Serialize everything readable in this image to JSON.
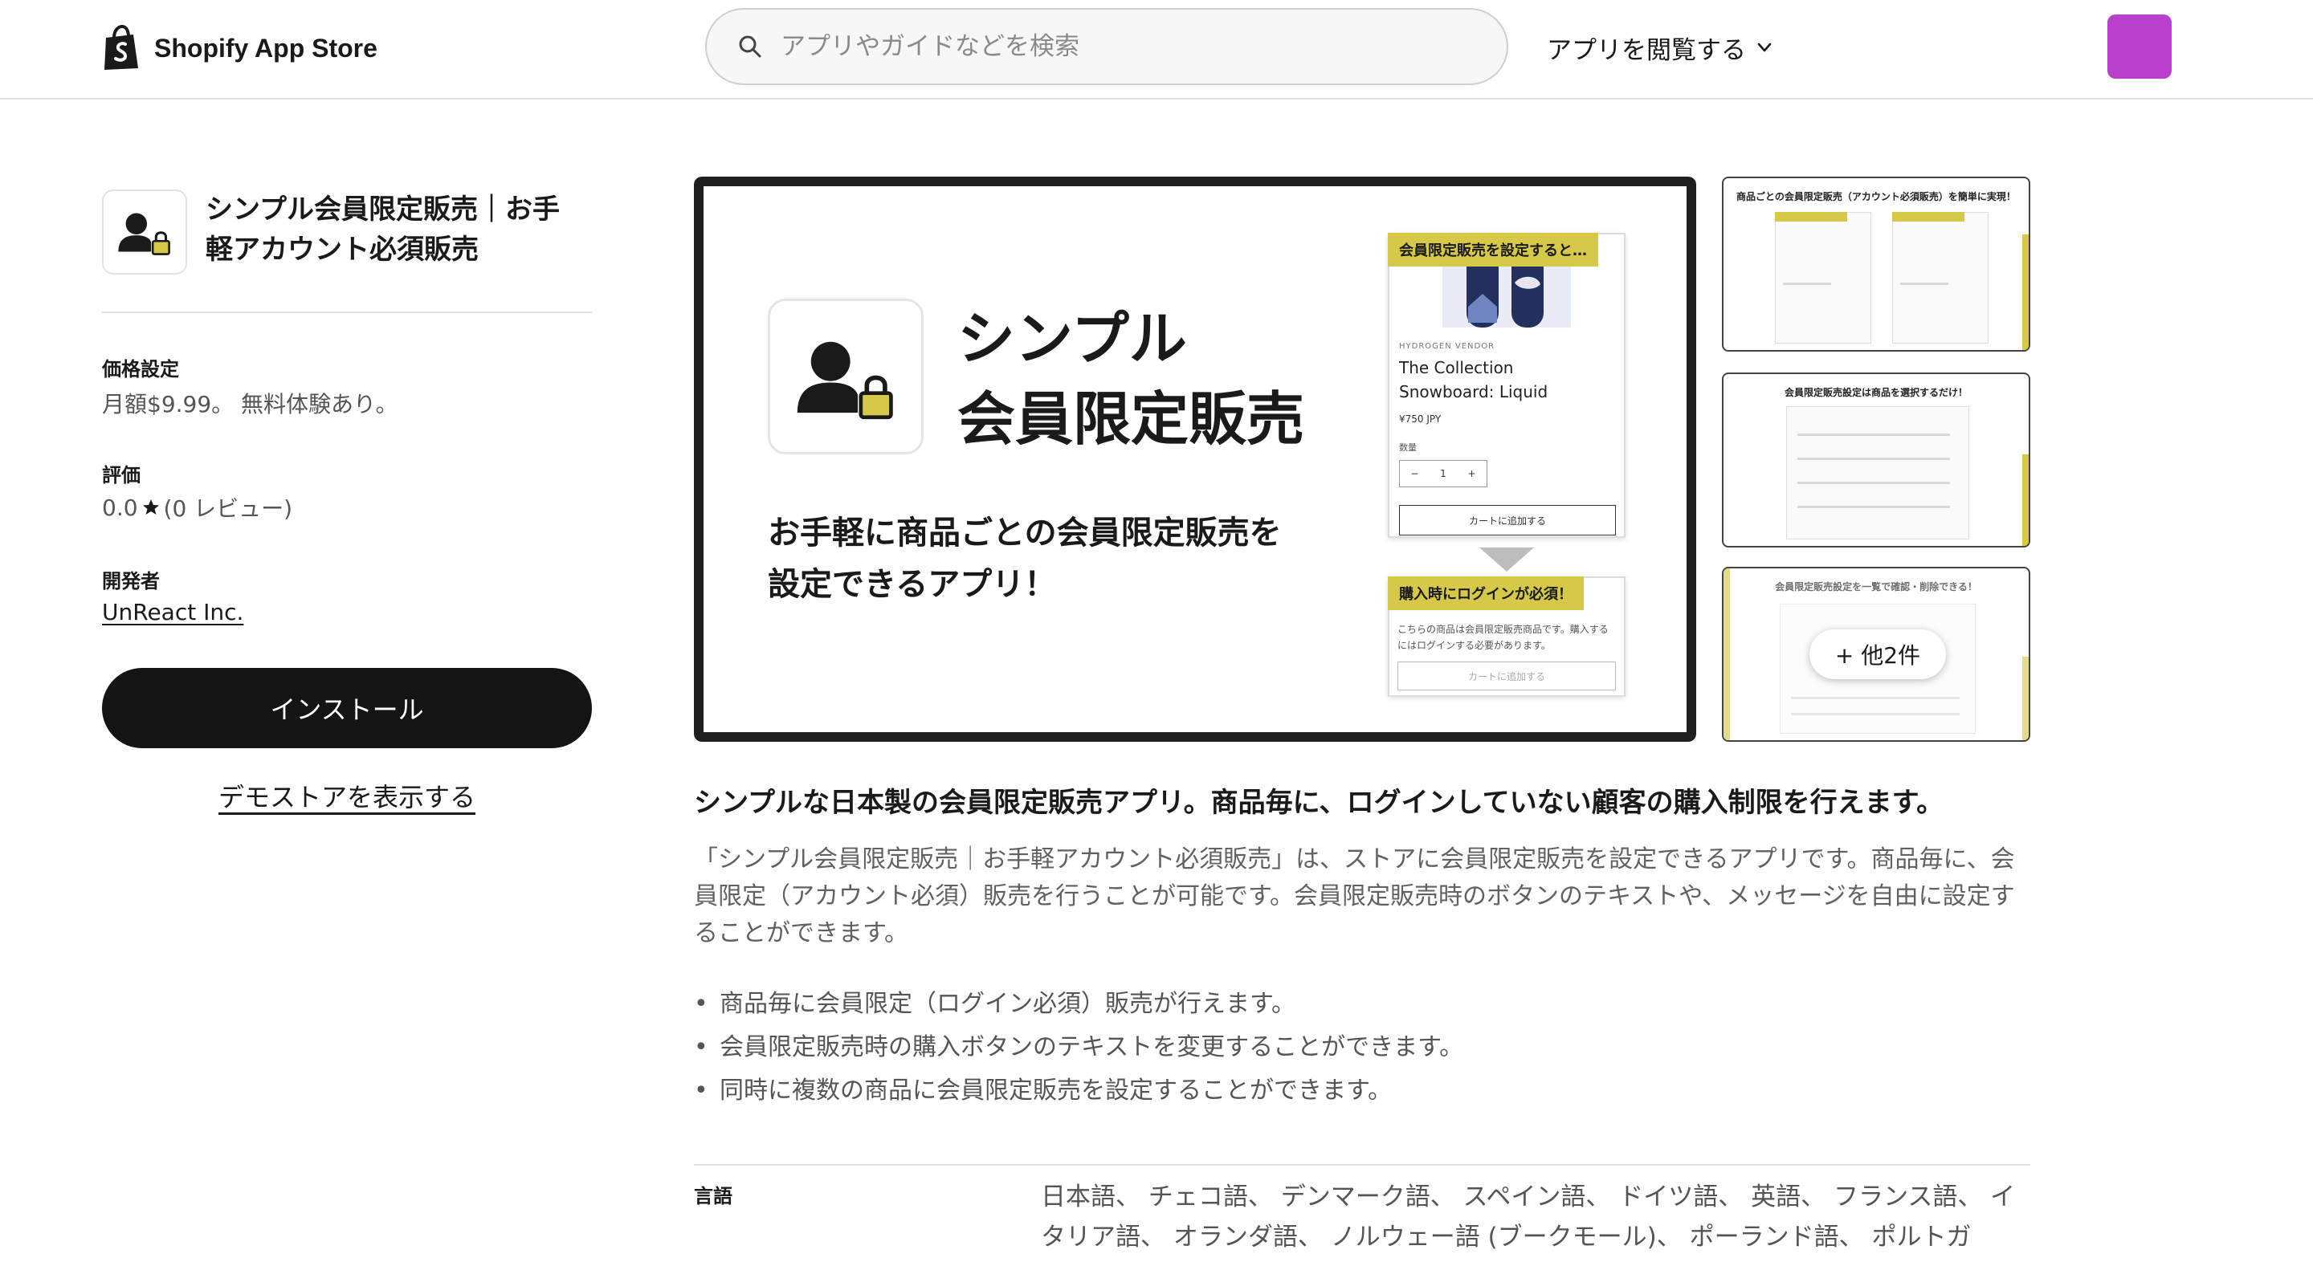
{
  "header": {
    "logo_text": "Shopify App Store",
    "search_placeholder": "アプリやガイドなどを検索",
    "browse_label": "アプリを閲覧する",
    "avatar_color": "#b93fcd"
  },
  "app": {
    "title": "シンプル会員限定販売｜お手軽アカウント必須販売",
    "pricing_label": "価格設定",
    "pricing_value": "月額$9.99。 無料体験あり。",
    "rating_label": "評価",
    "rating_score": "0.0",
    "rating_count": "(0 レビュー)",
    "rating_value": 0.0,
    "developer_label": "開発者",
    "developer_name": "UnReact Inc.",
    "install_label": "インストール",
    "demo_label": "デモストアを表示する"
  },
  "hero": {
    "title_line1": "シンプル",
    "title_line2": "会員限定販売",
    "subtitle_line1": "お手軽に商品ごとの会員限定販売を",
    "subtitle_line2": "設定できるアプリ！",
    "mock_tag1": "会員限定販売を設定すると…",
    "mock_vendor": "HYDROGEN VENDOR",
    "mock_product_line1": "The Collection",
    "mock_product_line2": "Snowboard: Liquid",
    "mock_price": "¥750 JPY",
    "mock_qty_label": "数量",
    "mock_qty_minus": "−",
    "mock_qty_value": "1",
    "mock_qty_plus": "+",
    "mock_cart": "カートに追加する",
    "mock_tag2": "購入時にログインが必須！",
    "mock_message": "こちらの商品は会員限定販売商品です。購入するにはログインする必要があります。",
    "mock_cart_disabled": "カートに追加する",
    "accent_color": "#d6c94a"
  },
  "thumbnails": {
    "thumb1_title": "商品ごとの会員限定販売（アカウント必須販売）を簡単に実現！",
    "thumb2_title": "会員限定販売設定は商品を選択するだけ！",
    "thumb3_title": "会員限定販売設定を一覧で確認・削除できる！",
    "more_label": "+ 他2件"
  },
  "description": {
    "headline": "シンプルな日本製の会員限定販売アプリ。商品毎に、ログインしていない顧客の購入制限を行えます。",
    "body": "「シンプル会員限定販売｜お手軽アカウント必須販売」は、ストアに会員限定販売を設定できるアプリです。商品毎に、会員限定（アカウント必須）販売を行うことが可能です。会員限定販売時のボタンのテキストや、メッセージを自由に設定することができます。",
    "features": [
      "商品毎に会員限定（ログイン必須）販売が行えます。",
      "会員限定販売時の購入ボタンのテキストを変更することができます。",
      "同時に複数の商品に会員限定販売を設定することができます。"
    ]
  },
  "details": {
    "language_label": "言語",
    "language_value": "日本語、 チェコ語、 デンマーク語、 スペイン語、 ドイツ語、 英語、 フランス語、 イタリア語、 オランダ語、 ノルウェー語 (ブークモール)、 ポーランド語、 ポルトガ"
  }
}
